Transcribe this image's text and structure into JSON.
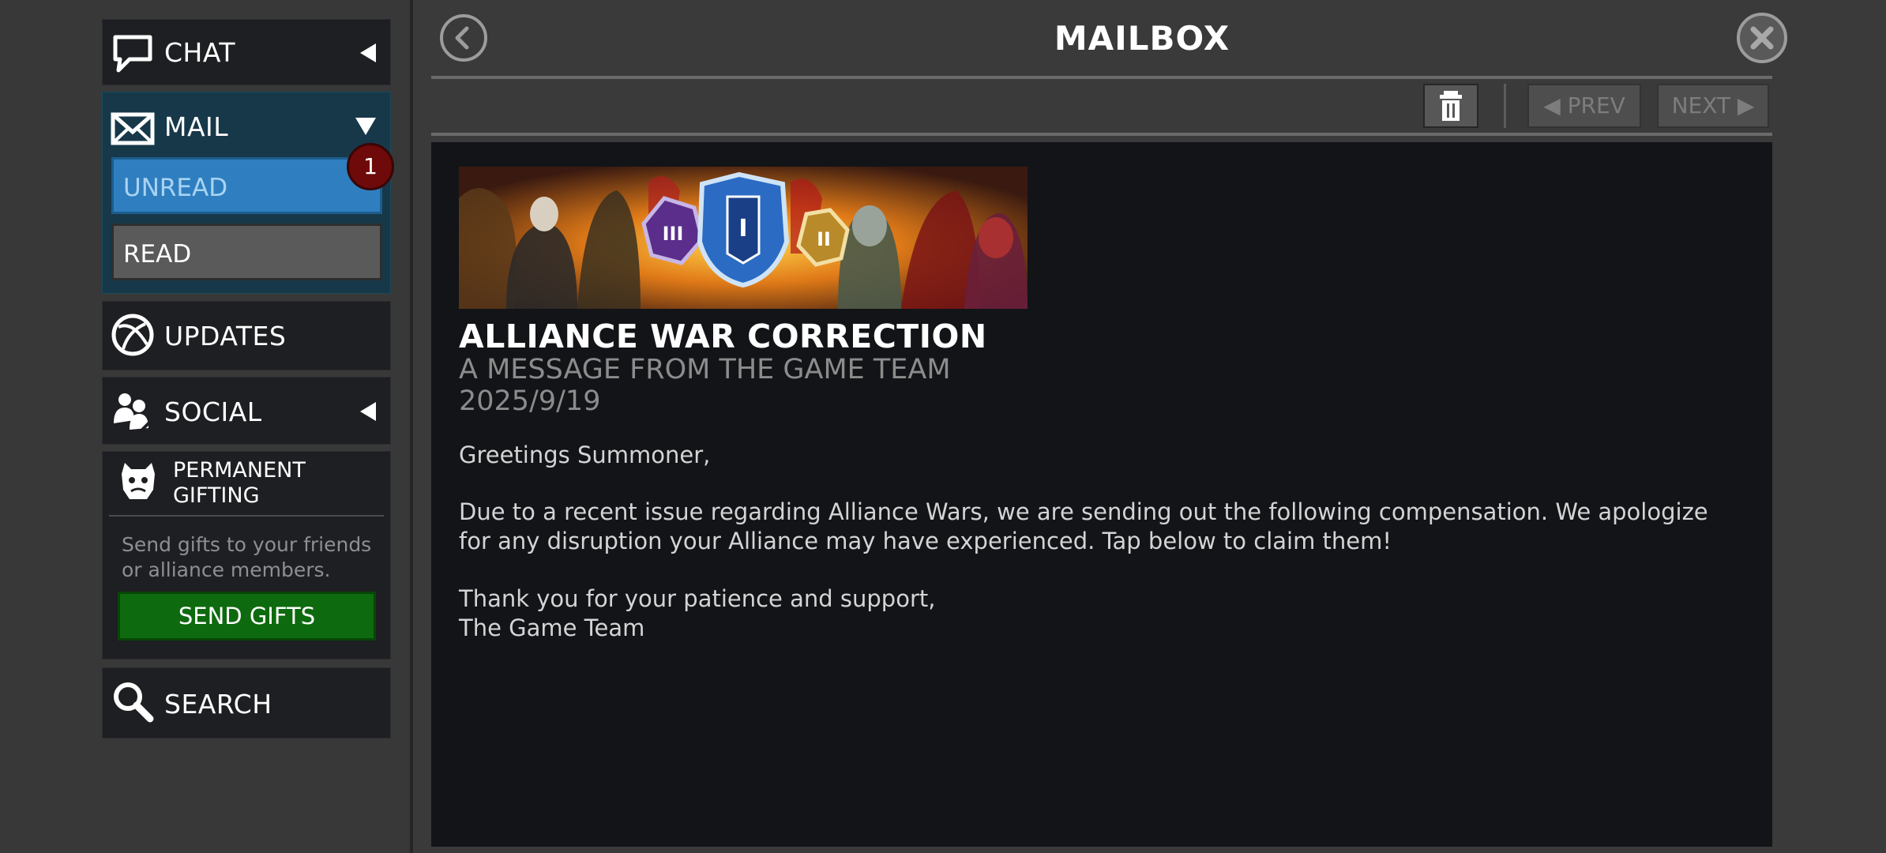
{
  "sidebar": {
    "chat_label": "CHAT",
    "mail_label": "MAIL",
    "unread_label": "UNREAD",
    "unread_count": "1",
    "read_label": "READ",
    "updates_label": "UPDATES",
    "social_label": "SOCIAL",
    "gifting_title": "PERMANENT GIFTING",
    "gifting_desc": "Send gifts to your friends or alliance members.",
    "send_gifts_label": "SEND GIFTS",
    "search_label": "SEARCH"
  },
  "header": {
    "title": "MAILBOX",
    "prev_label": "◀ PREV",
    "next_label": "NEXT ▶"
  },
  "message": {
    "title": "ALLIANCE WAR CORRECTION",
    "subtitle": "A MESSAGE FROM THE GAME TEAM",
    "date": "2025/9/19",
    "greeting": "Greetings Summoner,",
    "paragraph": "Due to a recent issue regarding Alliance Wars, we are sending out the following compensation. We apologize for any disruption your Alliance may have experienced. Tap below to claim them!",
    "thanks": "Thank you for your patience and support,",
    "signature": "The Game Team",
    "banner_badges": [
      "III",
      "I",
      "II"
    ]
  },
  "colors": {
    "unread_bg": "#2f7fc0",
    "send_gifts_bg": "#0e6a0e",
    "badge_bg": "#6e0a0a",
    "mail_group_bg": "#173849"
  }
}
